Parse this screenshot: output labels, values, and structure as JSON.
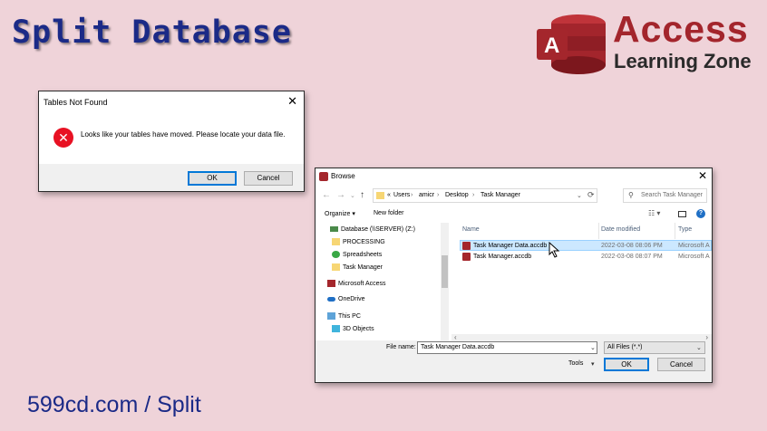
{
  "slide": {
    "title": "Split Database",
    "footer": "599cd.com / Split",
    "logo_line1": "Access",
    "logo_line2": "Learning Zone",
    "logo_letter": "A"
  },
  "message_box": {
    "title": "Tables Not Found",
    "message": "Looks like your tables have moved. Please locate your data file.",
    "ok_label": "OK",
    "cancel_label": "Cancel"
  },
  "browse": {
    "title": "Browse",
    "path": [
      "«",
      "Users",
      "amicr",
      "Desktop",
      "Task Manager"
    ],
    "search_placeholder": "Search Task Manager",
    "organize_label": "Organize ▾",
    "new_folder_label": "New folder",
    "nav_items": [
      {
        "label": "Database (\\\\SERVER) (Z:)",
        "icon": "network-drive-icon"
      },
      {
        "label": "PROCESSING",
        "icon": "folder-icon"
      },
      {
        "label": "Spreadsheets",
        "icon": "folder-icon"
      },
      {
        "label": "Task Manager",
        "icon": "folder-icon"
      },
      {
        "label": "Microsoft Access",
        "icon": "access-icon"
      },
      {
        "label": "OneDrive",
        "icon": "cloud-icon"
      },
      {
        "label": "This PC",
        "icon": "computer-icon"
      },
      {
        "label": "3D Objects",
        "icon": "3d-objects-icon"
      }
    ],
    "columns": {
      "name": "Name",
      "date": "Date modified",
      "type": "Type"
    },
    "files": [
      {
        "name": "Task Manager Data.accdb",
        "date": "2022-03-08 08:06 PM",
        "type": "Microsoft A"
      },
      {
        "name": "Task Manager.accdb",
        "date": "2022-03-08 08:07 PM",
        "type": "Microsoft A"
      }
    ],
    "file_name_label": "File name:",
    "file_name_value": "Task Manager Data.accdb",
    "filter_value": "All Files (*.*)",
    "tools_label": "Tools",
    "ok_label": "OK",
    "cancel_label": "Cancel"
  },
  "colors": {
    "accent": "#0078d7",
    "title": "#1b2a87",
    "brand": "#a3252c"
  }
}
